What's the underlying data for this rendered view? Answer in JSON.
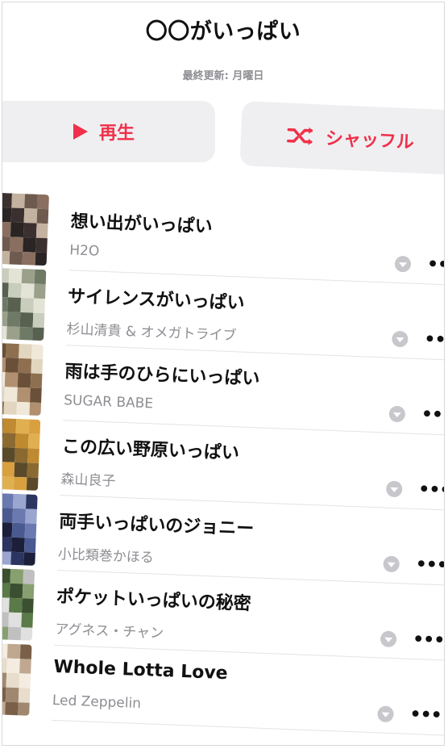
{
  "header": {
    "title": "〇〇がいっぱい",
    "updated": "最終更新: 月曜日"
  },
  "actions": {
    "play_label": "再生",
    "shuffle_label": "シャッフル",
    "accent_color": "#f0304a"
  },
  "songs": [
    {
      "title": "想い出がいっぱい",
      "artist": "H2O"
    },
    {
      "title": "サイレンスがいっぱい",
      "artist": "杉山清貴 & オメガトライブ"
    },
    {
      "title": "雨は手のひらにいっぱい",
      "artist": "SUGAR BABE"
    },
    {
      "title": "この広い野原いっぱい",
      "artist": "森山良子"
    },
    {
      "title": "両手いっぱいのジョニー",
      "artist": "小比類巻かほる"
    },
    {
      "title": "ポケットいっぱいの秘密",
      "artist": "アグネス・チャン"
    },
    {
      "title": "Whole Lotta Love",
      "artist": "Led Zeppelin"
    }
  ],
  "icons": {
    "row_download": "download-icon",
    "row_more": "more-icon",
    "more_glyph": "•••"
  }
}
